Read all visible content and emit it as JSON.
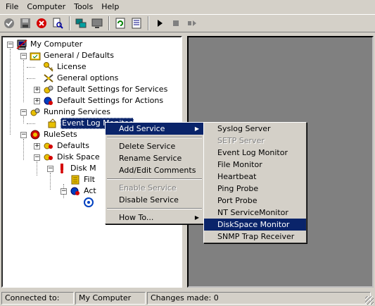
{
  "menu": {
    "file": "File",
    "computer": "Computer",
    "tools": "Tools",
    "help": "Help"
  },
  "toolbar": {
    "icons": [
      "connect-icon",
      "save-icon",
      "stop-red-icon",
      "find-icon",
      "network-icon",
      "monitor-icon",
      "refresh-icon",
      "properties-icon",
      "play-icon",
      "stop-icon",
      "pause-icon"
    ]
  },
  "tree": {
    "root": "My Computer",
    "general": "General / Defaults",
    "license": "License",
    "general_options": "General options",
    "default_services": "Default Settings for Services",
    "default_actions": "Default Settings for Actions",
    "running_services": "Running Services",
    "event_log_monitor": "Event Log Monitor",
    "rulesets": "RuleSets",
    "defaults": "Defaults",
    "disk_space": "Disk Space",
    "disk_m": "Disk M",
    "filt": "Filt",
    "act": "Act"
  },
  "context_menu": {
    "add_service": "Add Service",
    "delete_service": "Delete Service",
    "rename_service": "Rename Service",
    "add_edit_comments": "Add/Edit Comments",
    "enable_service": "Enable Service",
    "disable_service": "Disable Service",
    "how_to": "How To..."
  },
  "submenu": {
    "items": [
      "Syslog Server",
      "SETP Server",
      "Event Log Monitor",
      "File Monitor",
      "Heartbeat",
      "Ping Probe",
      "Port Probe",
      "NT ServiceMonitor",
      "DiskSpace Monitor",
      "SNMP Trap Receiver"
    ],
    "disabled_index": 1,
    "highlighted_index": 8
  },
  "status": {
    "connected_label": "Connected to:",
    "computer": "My Computer",
    "changes": "Changes made: 0"
  },
  "colors": {
    "face": "#d4d0c8",
    "highlight": "#0a246a",
    "workspace": "#808080"
  }
}
